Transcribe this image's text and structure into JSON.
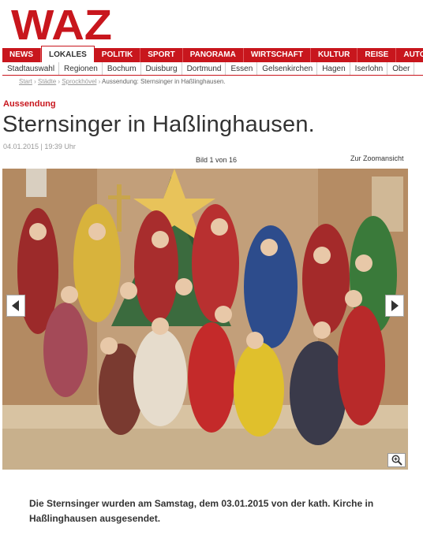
{
  "brand": {
    "logo_text": "WAZ",
    "color": "#c8161d"
  },
  "nav": {
    "main": [
      {
        "label": "NEWS"
      },
      {
        "label": "LOKALES",
        "active": true
      },
      {
        "label": "POLITIK"
      },
      {
        "label": "SPORT"
      },
      {
        "label": "PANORAMA"
      },
      {
        "label": "WIRTSCHAFT"
      },
      {
        "label": "KULTUR"
      },
      {
        "label": "REISE"
      },
      {
        "label": "AUTO"
      }
    ],
    "sub": [
      {
        "label": "Stadtauswahl"
      },
      {
        "label": "Regionen"
      },
      {
        "label": "Bochum"
      },
      {
        "label": "Duisburg"
      },
      {
        "label": "Dortmund"
      },
      {
        "label": "Essen"
      },
      {
        "label": "Gelsenkirchen"
      },
      {
        "label": "Hagen"
      },
      {
        "label": "Iserlohn"
      },
      {
        "label": "Ober"
      }
    ]
  },
  "breadcrumb": {
    "start": "Start",
    "staedte": "Städte",
    "city": "Sprockhövel",
    "current": "Aussendung: Sternsinger in Haßlinghausen."
  },
  "article": {
    "kicker": "Aussendung",
    "title": "Sternsinger in Haßlinghausen.",
    "date": "04.01.2015 | 19:39 Uhr"
  },
  "gallery": {
    "counter": "Bild 1 von 16",
    "zoom_link": "Zur Zoomansicht",
    "prev_icon": "chevron-left-icon",
    "next_icon": "chevron-right-icon",
    "zoom_icon": "magnifier-plus-icon",
    "caption": "Die Sternsinger wurden am Samstag, dem 03.01.2015 von der kath. Kirche in Haßlinghausen ausgesendet."
  }
}
